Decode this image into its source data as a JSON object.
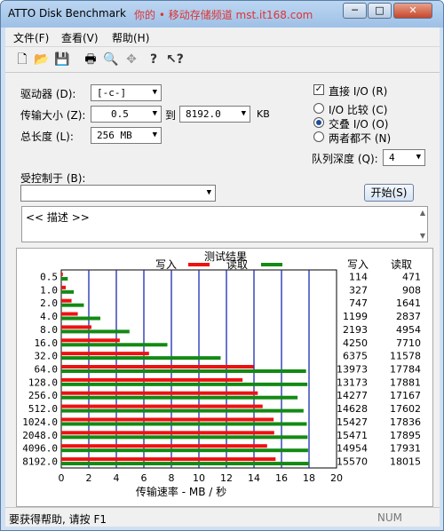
{
  "window": {
    "title": "ATTO Disk Benchmark",
    "watermark": "你的 • 移动存储频道 mst.it168.com"
  },
  "titlebar_buttons": {
    "minimize": "─",
    "maximize": "□",
    "close": "✕"
  },
  "menu": {
    "file": "文件(F)",
    "view": "查看(V)",
    "help": "帮助(H)"
  },
  "toolbar_icons": [
    "new-icon",
    "open-icon",
    "save-icon",
    "print-icon",
    "print-preview-icon",
    "move-icon",
    "help-icon",
    "context-help-icon"
  ],
  "form": {
    "drive_label": "驱动器 (D):",
    "drive_value": "[-c-]",
    "transfer_label": "传输大小 (Z):",
    "transfer_from": "0.5",
    "to_label": "到",
    "transfer_to": "8192.0",
    "kb_label": "KB",
    "length_label": "总长度 (L):",
    "length_value": "256 MB",
    "direct_io_label": "直接 I/O (R)",
    "direct_io_checked": true,
    "io_compare_label": "I/O 比较 (C)",
    "overlapped_io_label": "交叠 I/O (O)",
    "neither_label": "两者都不 (N)",
    "selected_mode": "overlapped",
    "queue_label": "队列深度 (Q):",
    "queue_value": "4",
    "controlled_by_label": "受控制于 (B):",
    "controlled_by_value": "",
    "start_button": "开始(S)",
    "description": "<< 描述 >>"
  },
  "chart_data": {
    "type": "bar",
    "title": "测试结果",
    "legend": [
      {
        "name": "写入",
        "color": "#ee1111"
      },
      {
        "name": "读取",
        "color": "#138a13"
      }
    ],
    "categories": [
      "0.5",
      "1.0",
      "2.0",
      "4.0",
      "8.0",
      "16.0",
      "32.0",
      "64.0",
      "128.0",
      "256.0",
      "512.0",
      "1024.0",
      "2048.0",
      "4096.0",
      "8192.0"
    ],
    "series": [
      {
        "name": "写入",
        "values": [
          114,
          327,
          747,
          1199,
          2193,
          4250,
          6375,
          13973,
          13173,
          14277,
          14628,
          15427,
          15471,
          14954,
          15570
        ]
      },
      {
        "name": "读取",
        "values": [
          471,
          908,
          1641,
          2837,
          4954,
          7710,
          11578,
          17784,
          17881,
          17167,
          17602,
          17836,
          17895,
          17931,
          18015
        ]
      }
    ],
    "xlabel": "传输速率 - MB / 秒",
    "xticks": [
      "0",
      "2",
      "4",
      "6",
      "8",
      "10",
      "12",
      "14",
      "16",
      "18",
      "20"
    ],
    "xlim": [
      0,
      20
    ],
    "column_headers": {
      "write": "写入",
      "read": "读取"
    },
    "grid": true
  },
  "status": {
    "help_text": "要获得帮助, 请按 F1",
    "num": "NUM"
  }
}
